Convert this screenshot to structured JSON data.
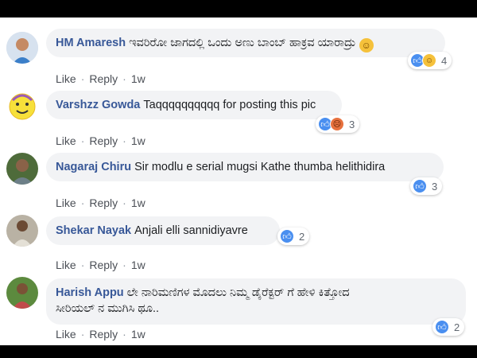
{
  "comments": [
    {
      "author": "HM Amaresh",
      "text": "ಇವರಿರೋ ಜಾಗದಲ್ಲಿ ಒಂದು ಅಣು ಬಾಂಬ್ ಹಾಕ್ರವ ಯಾರಾದ್ರು",
      "trailing_emoji": "laughing-emoji",
      "reactions": [
        "like",
        "haha"
      ],
      "reaction_count": "4",
      "like_label": "Like",
      "reply_label": "Reply",
      "time": "1w"
    },
    {
      "author": "Varshzz Gowda",
      "text": "Taqqqqqqqqqq for posting this pic",
      "reactions": [
        "like",
        "angry"
      ],
      "reaction_count": "3",
      "like_label": "Like",
      "reply_label": "Reply",
      "time": "1w"
    },
    {
      "author": "Nagaraj Chiru",
      "text": "Sir modlu e serial mugsi Kathe thumba helithidira",
      "reactions": [
        "like"
      ],
      "reaction_count": "3",
      "like_label": "Like",
      "reply_label": "Reply",
      "time": "1w"
    },
    {
      "author": "Shekar Nayak",
      "text": "Anjali elli sannidiyavre",
      "reactions": [
        "like"
      ],
      "reaction_count": "2",
      "like_label": "Like",
      "reply_label": "Reply",
      "time": "1w"
    },
    {
      "author": "Harish Appu",
      "text_line1": "ಲೇ ನಾರಿಮಣಿಗಳ ಮೊದಲು ನಿಮ್ಮ ಡೈರೆಕ್ಟರ್ ಗೆ ಹೇಳಿ ಕಿತ್ತೋದ",
      "text_line2": "ಸೀರಿಯಲ್ ನ ಮುಗಿಸಿ ಥೂ..",
      "reactions": [
        "like"
      ],
      "reaction_count": "2",
      "like_label": "Like",
      "reply_label": "Reply",
      "time": "1w"
    }
  ],
  "colors": {
    "author": "#385898",
    "bubble": "#f2f3f5",
    "like_blue": "#4a8ff0",
    "action_text": "#606770"
  }
}
